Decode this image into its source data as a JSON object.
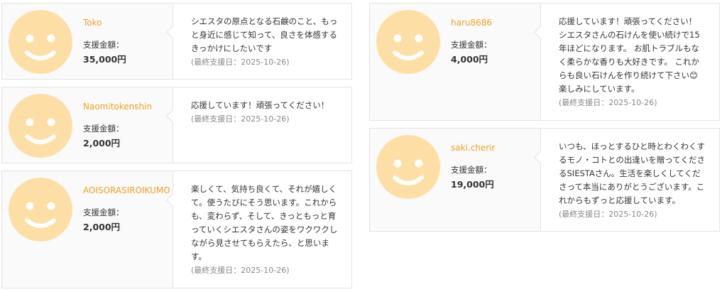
{
  "supporters": [
    {
      "name": "Toko",
      "amount_label": "支援金額：",
      "amount": "35,000円",
      "message_lines": [
        "シエスタの原点となる石鹸のこと、もっ",
        "と身近に感じて知って、良さを体感する",
        "きっかけにしたいです"
      ],
      "date": "(最終支援日：2025-10-26)"
    },
    {
      "name": "Naomitokenshin",
      "amount_label": "支援金額：",
      "amount": "2,000円",
      "message_lines": [
        "応援しています！頑張ってください！"
      ],
      "date": "(最終支援日：2025-10-26)"
    },
    {
      "name": "AOISORASIROIKUMO",
      "amount_label": "支援金額：",
      "amount": "2,000円",
      "message_lines": [
        "楽しくて、気持ち良くて、それが嬉しく",
        "て。使うたびにそう思います。これから",
        "も、変わらず、そして、きっともっと育",
        "っていくシエスタさんの姿をワクワクし",
        "ながら見させてもらえたら、と思いま",
        "す。"
      ],
      "date": "(最終支援日：2025-10-26)"
    },
    {
      "name": "haru8686",
      "amount_label": "支援金額：",
      "amount": "4,000円",
      "message_lines": [
        "応援しています！頑張ってください！",
        "シエスタさんの石けんを使い続けで15",
        "年ほどになります。 お肌トラブルもな",
        "く柔らかな香りも大好きです。 これか",
        "らも良い石けんを作り続けて下さい😊",
        "楽しみにしています。"
      ],
      "date": "(最終支援日：2025-10-26)"
    },
    {
      "name": "saki.cherir",
      "amount_label": "支援金額：",
      "amount": "19,000円",
      "message_lines": [
        "いつも、ほっとするひと時とわくわくす",
        "るモノ・コトとの出逢いを贈ってくださ",
        "るSIESTAさん。生活を楽しくしてくだ",
        "さって本当にありがとうございます。こ",
        "れからもずっと応援しています。"
      ],
      "date": "(最終支援日：2025-10-26)"
    }
  ],
  "colors": {
    "avatar_face": "#fddfa6",
    "avatar_features": "#ffffff",
    "name": "#f0a020"
  },
  "icons": {
    "avatar": "smiley-face-icon"
  }
}
